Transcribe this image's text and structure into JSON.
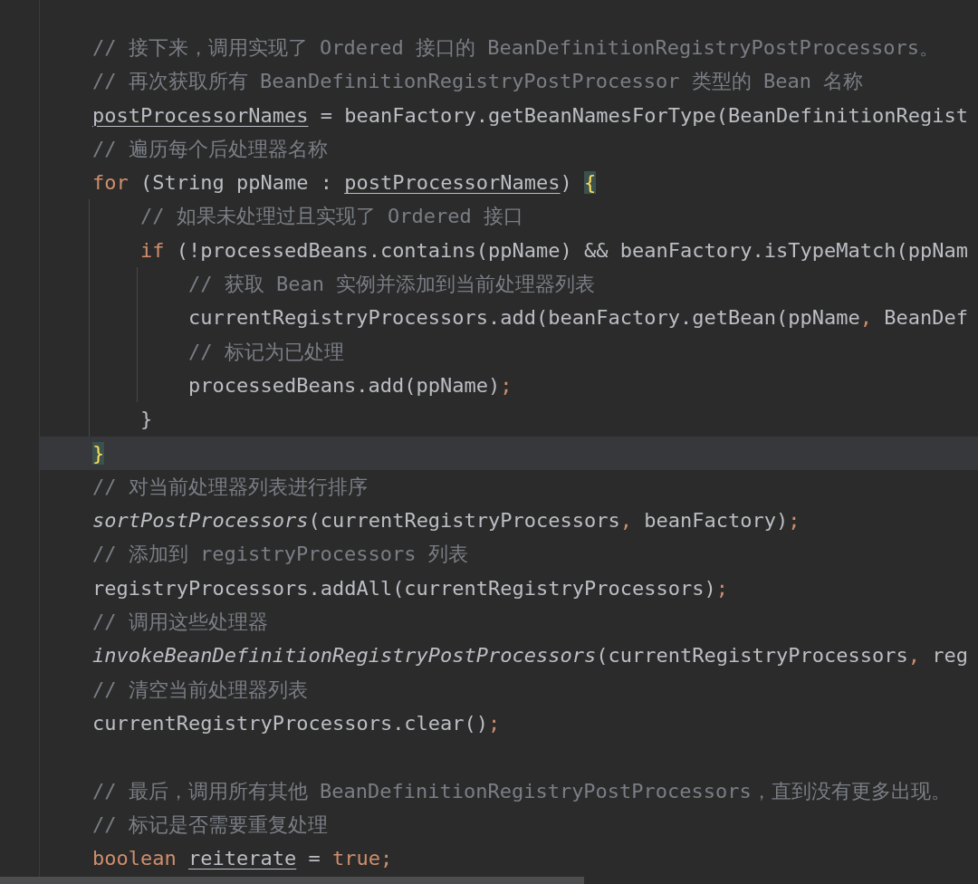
{
  "editor": {
    "lines": [
      {
        "kind": "code",
        "current": false,
        "tokens": [
          {
            "kind": "comment",
            "text": "// 接下来，调用实现了 Ordered 接口的 BeanDefinitionRegistryPostProcessors。"
          }
        ]
      },
      {
        "kind": "code",
        "current": false,
        "tokens": [
          {
            "kind": "comment",
            "text": "// 再次获取所有 BeanDefinitionRegistryPostProcessor 类型的 Bean 名称"
          }
        ]
      },
      {
        "kind": "code",
        "current": false,
        "tokens": [
          {
            "kind": "reassigned",
            "text": "postProcessorNames"
          },
          {
            "kind": "plain",
            "text": " = beanFactory.getBeanNamesForType(BeanDefinitionRegist"
          }
        ]
      },
      {
        "kind": "code",
        "current": false,
        "tokens": [
          {
            "kind": "comment",
            "text": "// 遍历每个后处理器名称"
          }
        ]
      },
      {
        "kind": "code",
        "current": false,
        "tokens": [
          {
            "kind": "keyword",
            "text": "for"
          },
          {
            "kind": "plain",
            "text": " (String ppName : "
          },
          {
            "kind": "reassigned",
            "text": "postProcessorNames"
          },
          {
            "kind": "plain",
            "text": ") "
          },
          {
            "kind": "brace-match",
            "text": "{"
          }
        ],
        "children": [
          {
            "kind": "code",
            "current": false,
            "tokens": [
              {
                "kind": "comment",
                "text": "// 如果未处理过且实现了 Ordered 接口"
              }
            ]
          },
          {
            "kind": "code",
            "current": false,
            "tokens": [
              {
                "kind": "keyword",
                "text": "if"
              },
              {
                "kind": "plain",
                "text": " (!processedBeans.contains(ppName) && beanFactory.isTypeMatch(ppNam"
              }
            ],
            "children": [
              {
                "kind": "code",
                "current": false,
                "tokens": [
                  {
                    "kind": "comment",
                    "text": "// 获取 Bean 实例并添加到当前处理器列表"
                  }
                ]
              },
              {
                "kind": "code",
                "current": false,
                "tokens": [
                  {
                    "kind": "plain",
                    "text": "currentRegistryProcessors.add(beanFactory.getBean(ppName"
                  },
                  {
                    "kind": "punct",
                    "text": ","
                  },
                  {
                    "kind": "plain",
                    "text": " BeanDef"
                  }
                ]
              },
              {
                "kind": "code",
                "current": false,
                "tokens": [
                  {
                    "kind": "comment",
                    "text": "// 标记为已处理"
                  }
                ]
              },
              {
                "kind": "code",
                "current": false,
                "tokens": [
                  {
                    "kind": "plain",
                    "text": "processedBeans.add(ppName)"
                  },
                  {
                    "kind": "punct",
                    "text": ";"
                  }
                ]
              }
            ]
          },
          {
            "kind": "code",
            "current": false,
            "tokens": [
              {
                "kind": "plain",
                "text": "}"
              }
            ]
          }
        ]
      },
      {
        "kind": "code",
        "current": true,
        "tokens": [
          {
            "kind": "brace-match",
            "text": "}"
          }
        ]
      },
      {
        "kind": "code",
        "current": false,
        "tokens": [
          {
            "kind": "comment",
            "text": "// 对当前处理器列表进行排序"
          }
        ]
      },
      {
        "kind": "code",
        "current": false,
        "tokens": [
          {
            "kind": "static",
            "text": "sortPostProcessors"
          },
          {
            "kind": "plain",
            "text": "(currentRegistryProcessors"
          },
          {
            "kind": "punct",
            "text": ","
          },
          {
            "kind": "plain",
            "text": " beanFactory)"
          },
          {
            "kind": "punct",
            "text": ";"
          }
        ]
      },
      {
        "kind": "code",
        "current": false,
        "tokens": [
          {
            "kind": "comment",
            "text": "// 添加到 registryProcessors 列表"
          }
        ]
      },
      {
        "kind": "code",
        "current": false,
        "tokens": [
          {
            "kind": "plain",
            "text": "registryProcessors.addAll(currentRegistryProcessors)"
          },
          {
            "kind": "punct",
            "text": ";"
          }
        ]
      },
      {
        "kind": "code",
        "current": false,
        "tokens": [
          {
            "kind": "comment",
            "text": "// 调用这些处理器"
          }
        ]
      },
      {
        "kind": "code",
        "current": false,
        "tokens": [
          {
            "kind": "static",
            "text": "invokeBeanDefinitionRegistryPostProcessors"
          },
          {
            "kind": "plain",
            "text": "(currentRegistryProcessors"
          },
          {
            "kind": "punct",
            "text": ","
          },
          {
            "kind": "plain",
            "text": " reg"
          }
        ]
      },
      {
        "kind": "code",
        "current": false,
        "tokens": [
          {
            "kind": "comment",
            "text": "// 清空当前处理器列表"
          }
        ]
      },
      {
        "kind": "code",
        "current": false,
        "tokens": [
          {
            "kind": "plain",
            "text": "currentRegistryProcessors.clear()"
          },
          {
            "kind": "punct",
            "text": ";"
          }
        ]
      },
      {
        "kind": "blank"
      },
      {
        "kind": "code",
        "current": false,
        "tokens": [
          {
            "kind": "comment",
            "text": "// 最后，调用所有其他 BeanDefinitionRegistryPostProcessors，直到没有更多出现。"
          }
        ]
      },
      {
        "kind": "code",
        "current": false,
        "tokens": [
          {
            "kind": "comment",
            "text": "// 标记是否需要重复处理"
          }
        ]
      },
      {
        "kind": "code",
        "current": false,
        "tokens": [
          {
            "kind": "keyword",
            "text": "boolean "
          },
          {
            "kind": "reassigned",
            "text": "reiterate"
          },
          {
            "kind": "plain",
            "text": " = "
          },
          {
            "kind": "keyword",
            "text": "true"
          },
          {
            "kind": "punct",
            "text": ";"
          }
        ]
      }
    ]
  }
}
